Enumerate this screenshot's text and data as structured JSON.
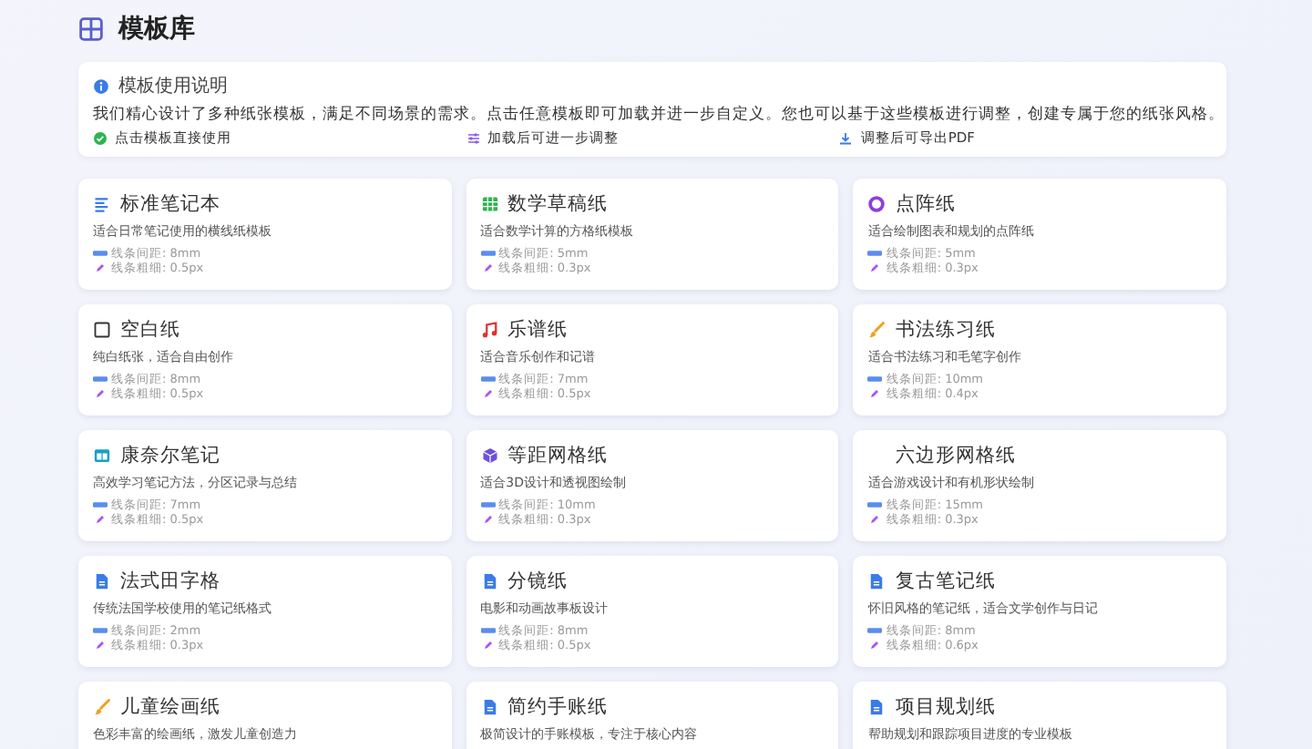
{
  "header": {
    "title": "模板库"
  },
  "info": {
    "title": "模板使用说明",
    "text": "我们精心设计了多种纸张模板，满足不同场景的需求。点击任意模板即可加载并进一步自定义。您也可以基于这些模板进行调整，创建专属于您的纸张风格。",
    "tips": [
      {
        "kind": "check",
        "text": "点击模板直接使用"
      },
      {
        "kind": "sliders",
        "text": "加载后可进一步调整"
      },
      {
        "kind": "download",
        "text": "调整后可导出PDF"
      }
    ]
  },
  "templates": [
    {
      "kind": "lines",
      "name": "标准笔记本",
      "desc": "适合日常笔记使用的横线纸模板",
      "spacing": "线条间距: 8mm",
      "thickness": "线条粗细: 0.5px"
    },
    {
      "kind": "grid",
      "name": "数学草稿纸",
      "desc": "适合数学计算的方格纸模板",
      "spacing": "线条间距: 5mm",
      "thickness": "线条粗细: 0.3px"
    },
    {
      "kind": "dot",
      "name": "点阵纸",
      "desc": "适合绘制图表和规划的点阵纸",
      "spacing": "线条间距: 5mm",
      "thickness": "线条粗细: 0.3px"
    },
    {
      "kind": "blank",
      "name": "空白纸",
      "desc": "纯白纸张，适合自由创作",
      "spacing": "线条间距: 8mm",
      "thickness": "线条粗细: 0.5px"
    },
    {
      "kind": "music",
      "name": "乐谱纸",
      "desc": "适合音乐创作和记谱",
      "spacing": "线条间距: 7mm",
      "thickness": "线条粗细: 0.5px"
    },
    {
      "kind": "brush",
      "name": "书法练习纸",
      "desc": "适合书法练习和毛笔字创作",
      "spacing": "线条间距: 10mm",
      "thickness": "线条粗细: 0.4px"
    },
    {
      "kind": "columns",
      "name": "康奈尔笔记",
      "desc": "高效学习笔记方法，分区记录与总结",
      "spacing": "线条间距: 7mm",
      "thickness": "线条粗细: 0.5px"
    },
    {
      "kind": "cube",
      "name": "等距网格纸",
      "desc": "适合3D设计和透视图绘制",
      "spacing": "线条间距: 10mm",
      "thickness": "线条粗细: 0.3px"
    },
    {
      "name": "六边形网格纸",
      "desc": "适合游戏设计和有机形状绘制",
      "spacing": "线条间距: 15mm",
      "thickness": "线条粗细: 0.3px"
    },
    {
      "kind": "document",
      "name": "法式田字格",
      "desc": "传统法国学校使用的笔记纸格式",
      "spacing": "线条间距: 2mm",
      "thickness": "线条粗细: 0.3px"
    },
    {
      "kind": "document",
      "name": "分镜纸",
      "desc": "电影和动画故事板设计",
      "spacing": "线条间距: 8mm",
      "thickness": "线条粗细: 0.5px"
    },
    {
      "kind": "document",
      "name": "复古笔记纸",
      "desc": "怀旧风格的笔记纸，适合文学创作与日记",
      "spacing": "线条间距: 8mm",
      "thickness": "线条粗细: 0.6px"
    },
    {
      "kind": "brush",
      "name": "儿童绘画纸",
      "desc": "色彩丰富的绘画纸，激发儿童创造力"
    },
    {
      "kind": "document",
      "name": "简约手账纸",
      "desc": "极简设计的手账模板，专注于核心内容"
    },
    {
      "kind": "document",
      "name": "项目规划纸",
      "desc": "帮助规划和跟踪项目进度的专业模板"
    }
  ]
}
